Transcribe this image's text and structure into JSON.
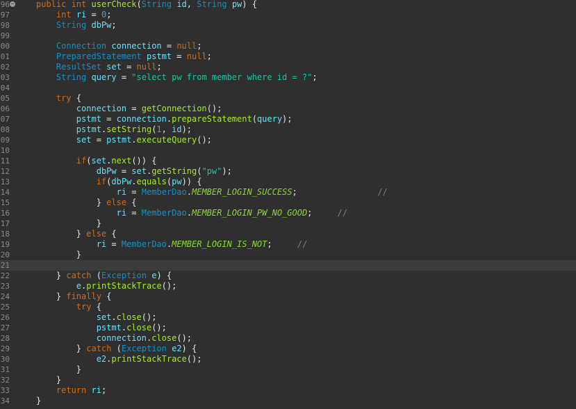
{
  "editor": {
    "lines": [
      {
        "n": "96",
        "fold": "−",
        "segs": [
          [
            "kw",
            "public "
          ],
          [
            "kw",
            "int "
          ],
          [
            "fn",
            "userCheck"
          ],
          [
            "punc",
            "("
          ],
          [
            "ty",
            "String "
          ],
          [
            "var",
            "id"
          ],
          [
            "punc",
            ", "
          ],
          [
            "ty",
            "String "
          ],
          [
            "var",
            "pw"
          ],
          [
            "punc",
            ") {"
          ]
        ]
      },
      {
        "n": "97",
        "segs": [
          [
            "plain",
            "    "
          ],
          [
            "kw",
            "int "
          ],
          [
            "var",
            "ri"
          ],
          [
            "plain",
            " = "
          ],
          [
            "num",
            "0"
          ],
          [
            "punc",
            ";"
          ]
        ]
      },
      {
        "n": "98",
        "segs": [
          [
            "plain",
            "    "
          ],
          [
            "ty",
            "String "
          ],
          [
            "var",
            "dbPw"
          ],
          [
            "punc",
            ";"
          ]
        ]
      },
      {
        "n": "99",
        "segs": []
      },
      {
        "n": "00",
        "segs": [
          [
            "plain",
            "    "
          ],
          [
            "ty",
            "Connection "
          ],
          [
            "var",
            "connection"
          ],
          [
            "plain",
            " = "
          ],
          [
            "kw",
            "null"
          ],
          [
            "punc",
            ";"
          ]
        ]
      },
      {
        "n": "01",
        "segs": [
          [
            "plain",
            "    "
          ],
          [
            "ty",
            "PreparedStatement "
          ],
          [
            "var",
            "pstmt"
          ],
          [
            "plain",
            " = "
          ],
          [
            "kw",
            "null"
          ],
          [
            "punc",
            ";"
          ]
        ]
      },
      {
        "n": "02",
        "segs": [
          [
            "plain",
            "    "
          ],
          [
            "ty",
            "ResultSet "
          ],
          [
            "var",
            "set"
          ],
          [
            "plain",
            " = "
          ],
          [
            "kw",
            "null"
          ],
          [
            "punc",
            ";"
          ]
        ]
      },
      {
        "n": "03",
        "segs": [
          [
            "plain",
            "    "
          ],
          [
            "ty",
            "String "
          ],
          [
            "var",
            "query"
          ],
          [
            "plain",
            " = "
          ],
          [
            "str",
            "\"select pw from member where id = ?\""
          ],
          [
            "punc",
            ";"
          ]
        ]
      },
      {
        "n": "04",
        "segs": []
      },
      {
        "n": "05",
        "segs": [
          [
            "plain",
            "    "
          ],
          [
            "kw",
            "try "
          ],
          [
            "punc",
            "{"
          ]
        ]
      },
      {
        "n": "06",
        "segs": [
          [
            "plain",
            "        "
          ],
          [
            "var",
            "connection"
          ],
          [
            "plain",
            " = "
          ],
          [
            "fn",
            "getConnection"
          ],
          [
            "punc",
            "();"
          ]
        ]
      },
      {
        "n": "07",
        "segs": [
          [
            "plain",
            "        "
          ],
          [
            "var",
            "pstmt"
          ],
          [
            "plain",
            " = "
          ],
          [
            "var",
            "connection"
          ],
          [
            "punc",
            "."
          ],
          [
            "fn",
            "prepareStatement"
          ],
          [
            "punc",
            "("
          ],
          [
            "var",
            "query"
          ],
          [
            "punc",
            ");"
          ]
        ]
      },
      {
        "n": "08",
        "segs": [
          [
            "plain",
            "        "
          ],
          [
            "var",
            "pstmt"
          ],
          [
            "punc",
            "."
          ],
          [
            "fn",
            "setString"
          ],
          [
            "punc",
            "("
          ],
          [
            "num",
            "1"
          ],
          [
            "punc",
            ", "
          ],
          [
            "var",
            "id"
          ],
          [
            "punc",
            ");"
          ]
        ]
      },
      {
        "n": "09",
        "segs": [
          [
            "plain",
            "        "
          ],
          [
            "var",
            "set"
          ],
          [
            "plain",
            " = "
          ],
          [
            "var",
            "pstmt"
          ],
          [
            "punc",
            "."
          ],
          [
            "fn",
            "executeQuery"
          ],
          [
            "punc",
            "();"
          ]
        ]
      },
      {
        "n": "10",
        "segs": []
      },
      {
        "n": "11",
        "segs": [
          [
            "plain",
            "        "
          ],
          [
            "kw",
            "if"
          ],
          [
            "punc",
            "("
          ],
          [
            "var",
            "set"
          ],
          [
            "punc",
            "."
          ],
          [
            "fn",
            "next"
          ],
          [
            "punc",
            "()) {"
          ]
        ]
      },
      {
        "n": "12",
        "segs": [
          [
            "plain",
            "            "
          ],
          [
            "var",
            "dbPw"
          ],
          [
            "plain",
            " = "
          ],
          [
            "var",
            "set"
          ],
          [
            "punc",
            "."
          ],
          [
            "fn",
            "getString"
          ],
          [
            "punc",
            "("
          ],
          [
            "str",
            "\"pw\""
          ],
          [
            "punc",
            ");"
          ]
        ]
      },
      {
        "n": "13",
        "segs": [
          [
            "plain",
            "            "
          ],
          [
            "kw",
            "if"
          ],
          [
            "punc",
            "("
          ],
          [
            "var",
            "dbPw"
          ],
          [
            "punc",
            "."
          ],
          [
            "fn",
            "equals"
          ],
          [
            "punc",
            "("
          ],
          [
            "var",
            "pw"
          ],
          [
            "punc",
            ")) {"
          ]
        ]
      },
      {
        "n": "14",
        "segs": [
          [
            "plain",
            "                "
          ],
          [
            "var",
            "ri"
          ],
          [
            "plain",
            " = "
          ],
          [
            "cls",
            "MemberDao"
          ],
          [
            "punc",
            "."
          ],
          [
            "const",
            "MEMBER_LOGIN_SUCCESS"
          ],
          [
            "punc",
            ";"
          ],
          [
            "plain",
            "                "
          ],
          [
            "cm",
            "//"
          ]
        ]
      },
      {
        "n": "15",
        "segs": [
          [
            "plain",
            "            "
          ],
          [
            "punc",
            "} "
          ],
          [
            "kw",
            "else "
          ],
          [
            "punc",
            "{"
          ]
        ]
      },
      {
        "n": "16",
        "segs": [
          [
            "plain",
            "                "
          ],
          [
            "var",
            "ri"
          ],
          [
            "plain",
            " = "
          ],
          [
            "cls",
            "MemberDao"
          ],
          [
            "punc",
            "."
          ],
          [
            "const",
            "MEMBER_LOGIN_PW_NO_GOOD"
          ],
          [
            "punc",
            ";"
          ],
          [
            "plain",
            "     "
          ],
          [
            "cm",
            "//"
          ]
        ]
      },
      {
        "n": "17",
        "segs": [
          [
            "plain",
            "            "
          ],
          [
            "punc",
            "}"
          ]
        ]
      },
      {
        "n": "18",
        "segs": [
          [
            "plain",
            "        "
          ],
          [
            "punc",
            "} "
          ],
          [
            "kw",
            "else "
          ],
          [
            "punc",
            "{"
          ]
        ]
      },
      {
        "n": "19",
        "segs": [
          [
            "plain",
            "            "
          ],
          [
            "var",
            "ri"
          ],
          [
            "plain",
            " = "
          ],
          [
            "cls",
            "MemberDao"
          ],
          [
            "punc",
            "."
          ],
          [
            "const",
            "MEMBER_LOGIN_IS_NOT"
          ],
          [
            "punc",
            ";"
          ],
          [
            "plain",
            "     "
          ],
          [
            "cm",
            "//"
          ]
        ]
      },
      {
        "n": "20",
        "segs": [
          [
            "plain",
            "        "
          ],
          [
            "punc",
            "}"
          ]
        ]
      },
      {
        "n": "21",
        "current": true,
        "segs": []
      },
      {
        "n": "22",
        "segs": [
          [
            "plain",
            "    "
          ],
          [
            "punc",
            "} "
          ],
          [
            "kw",
            "catch "
          ],
          [
            "punc",
            "("
          ],
          [
            "ty",
            "Exception "
          ],
          [
            "var",
            "e"
          ],
          [
            "punc",
            ") {"
          ]
        ]
      },
      {
        "n": "23",
        "segs": [
          [
            "plain",
            "        "
          ],
          [
            "var",
            "e"
          ],
          [
            "punc",
            "."
          ],
          [
            "fn",
            "printStackTrace"
          ],
          [
            "punc",
            "();"
          ]
        ]
      },
      {
        "n": "24",
        "segs": [
          [
            "plain",
            "    "
          ],
          [
            "punc",
            "} "
          ],
          [
            "kw",
            "finally "
          ],
          [
            "punc",
            "{"
          ]
        ]
      },
      {
        "n": "25",
        "segs": [
          [
            "plain",
            "        "
          ],
          [
            "kw",
            "try "
          ],
          [
            "punc",
            "{"
          ]
        ]
      },
      {
        "n": "26",
        "segs": [
          [
            "plain",
            "            "
          ],
          [
            "var",
            "set"
          ],
          [
            "punc",
            "."
          ],
          [
            "fn",
            "close"
          ],
          [
            "punc",
            "();"
          ]
        ]
      },
      {
        "n": "27",
        "segs": [
          [
            "plain",
            "            "
          ],
          [
            "var",
            "pstmt"
          ],
          [
            "punc",
            "."
          ],
          [
            "fn",
            "close"
          ],
          [
            "punc",
            "();"
          ]
        ]
      },
      {
        "n": "28",
        "segs": [
          [
            "plain",
            "            "
          ],
          [
            "var",
            "connection"
          ],
          [
            "punc",
            "."
          ],
          [
            "fn",
            "close"
          ],
          [
            "punc",
            "();"
          ]
        ]
      },
      {
        "n": "29",
        "segs": [
          [
            "plain",
            "        "
          ],
          [
            "punc",
            "} "
          ],
          [
            "kw",
            "catch "
          ],
          [
            "punc",
            "("
          ],
          [
            "ty",
            "Exception "
          ],
          [
            "var",
            "e2"
          ],
          [
            "punc",
            ") {"
          ]
        ]
      },
      {
        "n": "30",
        "segs": [
          [
            "plain",
            "            "
          ],
          [
            "var",
            "e2"
          ],
          [
            "punc",
            "."
          ],
          [
            "fn",
            "printStackTrace"
          ],
          [
            "punc",
            "();"
          ]
        ]
      },
      {
        "n": "31",
        "segs": [
          [
            "plain",
            "        "
          ],
          [
            "punc",
            "}"
          ]
        ]
      },
      {
        "n": "32",
        "segs": [
          [
            "plain",
            "    "
          ],
          [
            "punc",
            "}"
          ]
        ]
      },
      {
        "n": "33",
        "segs": [
          [
            "plain",
            "    "
          ],
          [
            "kw",
            "return "
          ],
          [
            "var",
            "ri"
          ],
          [
            "punc",
            ";"
          ]
        ]
      },
      {
        "n": "34",
        "segs": [
          [
            "punc",
            "}"
          ]
        ]
      }
    ]
  }
}
